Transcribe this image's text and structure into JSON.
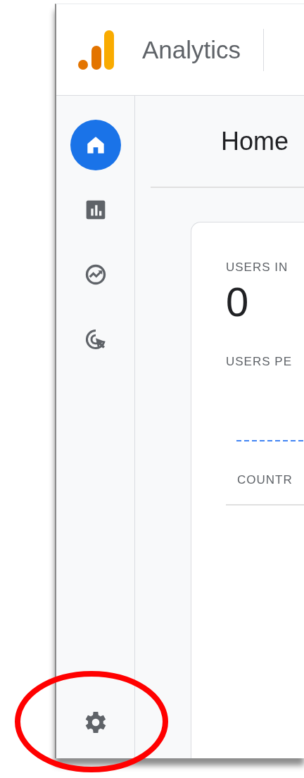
{
  "header": {
    "product": "Analytics"
  },
  "nav": [
    {
      "kind": "home",
      "selected": true
    },
    {
      "kind": "reports",
      "selected": false
    },
    {
      "kind": "explore",
      "selected": false
    },
    {
      "kind": "advertising",
      "selected": false
    }
  ],
  "page_title": "Home",
  "card": {
    "label_1": "USERS IN",
    "value": "0",
    "label_2": "USERS PE",
    "column_header": "COUNTR"
  }
}
